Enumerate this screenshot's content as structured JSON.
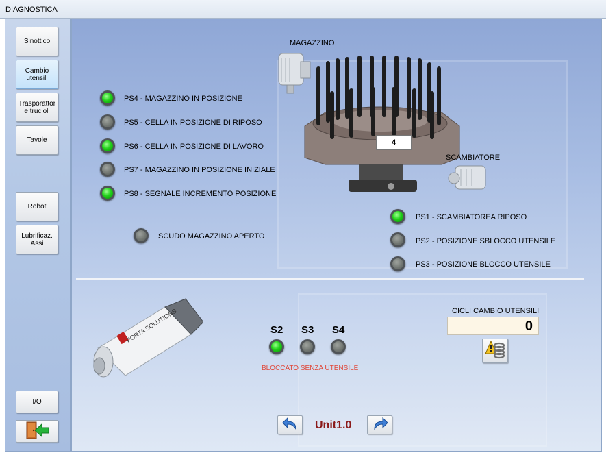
{
  "window": {
    "title": "DIAGNOSTICA"
  },
  "sidebar": {
    "buttons": [
      {
        "id": "sinottico",
        "label": "Sinottico",
        "active": false
      },
      {
        "id": "cambio-utensili",
        "label": "Cambio utensili",
        "active": true
      },
      {
        "id": "trasportatore",
        "label": "Trasporattor e trucioli",
        "active": false
      },
      {
        "id": "tavole",
        "label": "Tavole",
        "active": false
      },
      {
        "id": "robot",
        "label": "Robot",
        "active": false
      },
      {
        "id": "lubrificazione",
        "label": "Lubrificaz. Assi",
        "active": false
      },
      {
        "id": "io",
        "label": "I/O",
        "active": false
      }
    ],
    "exit_icon": "exit-door-arrow-icon"
  },
  "magazine": {
    "caption": "MAGAZZINO",
    "cell_number": "4",
    "sensors": [
      {
        "label": "PS4 - MAGAZZINO IN POSIZIONE",
        "state": "on"
      },
      {
        "label": "PS5 - CELLA IN POSIZIONE DI RIPOSO",
        "state": "off"
      },
      {
        "label": "PS6 - CELLA IN POSIZIONE DI LAVORO",
        "state": "on"
      },
      {
        "label": "PS7 - MAGAZZINO IN POSIZIONE INIZIALE",
        "state": "off"
      },
      {
        "label": "PS8 - SEGNALE INCREMENTO POSIZIONE",
        "state": "on"
      }
    ],
    "shield": {
      "label": "SCUDO MAGAZZINO APERTO",
      "state": "off"
    }
  },
  "exchanger": {
    "caption": "SCAMBIATORE",
    "sensors": [
      {
        "label": "PS1 - SCAMBIATOREA RIPOSO",
        "state": "on"
      },
      {
        "label": "PS2 - POSIZIONE SBLOCCO UTENSILE",
        "state": "off"
      },
      {
        "label": "PS3 - POSIZIONE BLOCCO UTENSILE",
        "state": "off"
      }
    ]
  },
  "spindle": {
    "brand": "PORTA SOLUTIONS",
    "sensors": [
      {
        "label": "S2",
        "state": "on"
      },
      {
        "label": "S3",
        "state": "off"
      },
      {
        "label": "S4",
        "state": "off"
      }
    ],
    "status": "BLOCCATO SENZA UTENSILE"
  },
  "counter": {
    "label": "CICLI CAMBIO UTENSILI",
    "value": "0",
    "reset_icon": "spring-warning-icon"
  },
  "footer": {
    "unit_label": "Unit1.0",
    "prev_icon": "arrow-back-icon",
    "next_icon": "arrow-forward-icon"
  },
  "colors": {
    "led_on": "#22d11a",
    "led_off": "#6f7470",
    "status_warning": "#e0483a",
    "unit_label": "#8b1a1a"
  }
}
